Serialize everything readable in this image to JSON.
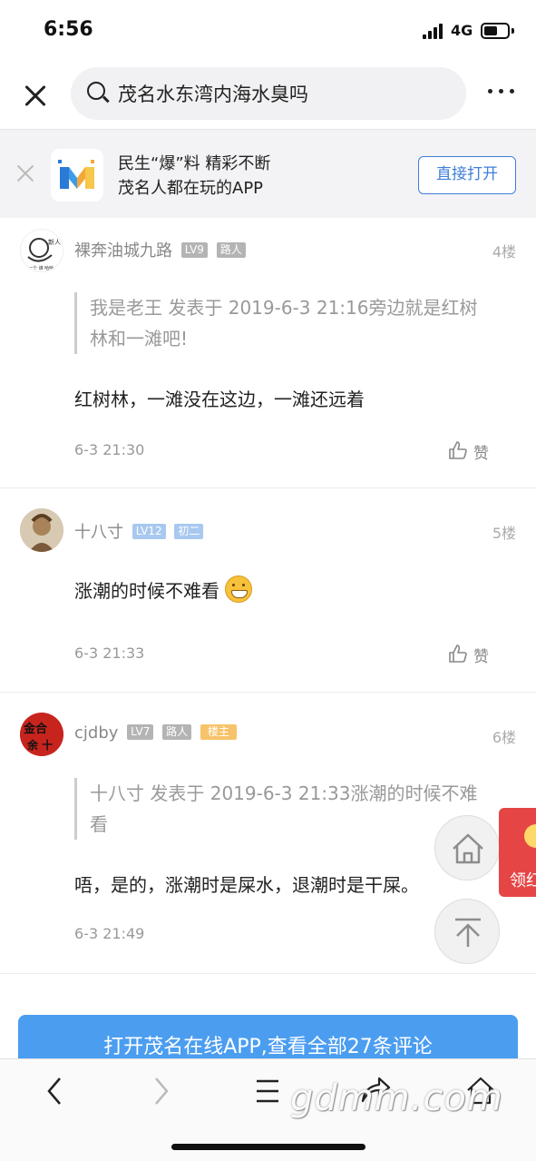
{
  "status_bar": {
    "time": "6:56",
    "network": "4G"
  },
  "search": {
    "query": "茂名水东湾内海水臭吗"
  },
  "promo": {
    "line1": "民生“爆”料 精彩不断",
    "line2": "茂名人都在玩的APP",
    "open_button": "直接打开"
  },
  "posts": [
    {
      "author": "裸奔油城九路",
      "level": "LV9",
      "rank": "路人",
      "floor": "4楼",
      "quote": "我是老王 发表于 2019-6-3 21:16旁边就是红树林和一滩吧!",
      "content": "红树林，一滩没在这边，一滩还远着",
      "time": "6-3 21:30",
      "like_label": "赞"
    },
    {
      "author": "十八寸",
      "level": "LV12",
      "rank": "初二",
      "floor": "5楼",
      "content": "涨潮的时候不难看",
      "time": "6-3 21:33",
      "like_label": "赞"
    },
    {
      "author": "cjdby",
      "level": "LV7",
      "rank": "路人",
      "owner_badge": "楼主",
      "floor": "6楼",
      "quote": "十八寸 发表于 2019-6-3 21:33涨潮的时候不难看",
      "content": "唔，是的，涨潮时是屎水，退潮时是干屎。",
      "time": "6-3 21:49"
    }
  ],
  "red_packet": {
    "label": "领红"
  },
  "open_app_bar": {
    "label": "打开茂名在线APP,查看全部27条评论"
  },
  "watermark": "gdmm.com",
  "colors": {
    "accent": "#3f7fd9",
    "cta": "#4b9df0",
    "red_packet": "#e64545"
  }
}
